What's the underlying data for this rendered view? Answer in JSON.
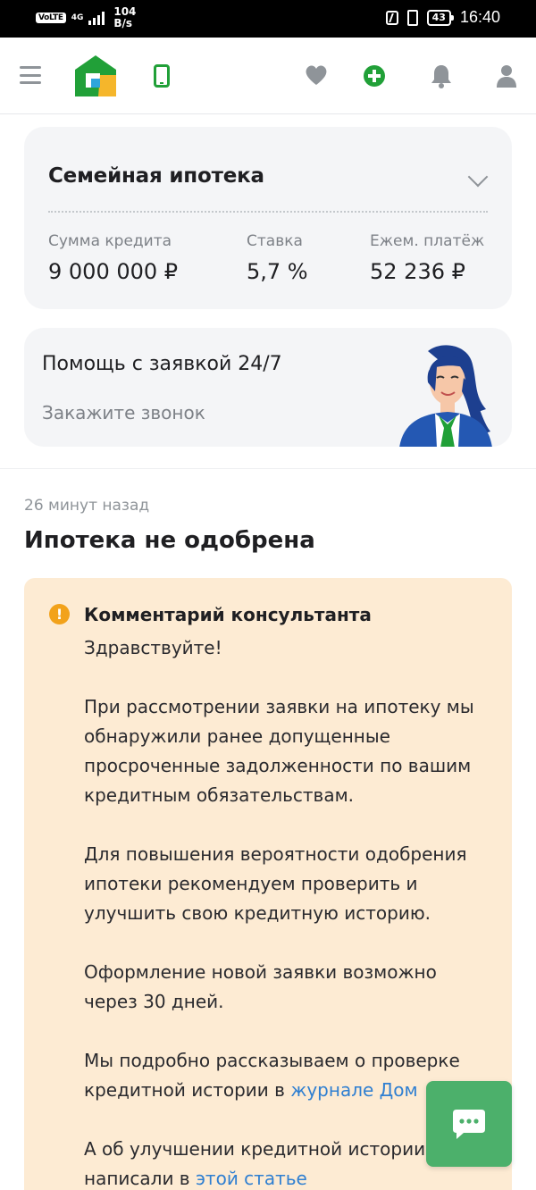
{
  "status_bar": {
    "volte": "VoLTE",
    "network": "4G",
    "speed_value": "104",
    "speed_unit": "B/s",
    "battery": "43",
    "time": "16:40"
  },
  "header": {
    "icons": [
      "menu-icon",
      "logo",
      "phone-icon",
      "heart-icon",
      "plus-icon",
      "bell-icon",
      "user-icon"
    ]
  },
  "mortgage": {
    "title": "Семейная ипотека",
    "stats": [
      {
        "label": "Сумма кредита",
        "value": "9 000 000 ₽"
      },
      {
        "label": "Ставка",
        "value": "5,7 %"
      },
      {
        "label": "Ежем. платёж",
        "value": "52 236 ₽"
      }
    ]
  },
  "help": {
    "title": "Помощь с заявкой 24/7",
    "subtitle": "Закажите звонок"
  },
  "application": {
    "time_ago": "26 минут назад",
    "status": "Ипотека не одобрена"
  },
  "comment": {
    "heading": "Комментарий консультанта",
    "greeting": "Здравствуйте!",
    "p1": "При рассмотрении заявки на ипотеку мы обнаружили ранее допущенные просроченные задолженности по вашим кредитным обязательствам.",
    "p2": "Для повышения вероятности одобрения ипотеки рекомендуем проверить и улучшить свою кредитную историю.",
    "p3": "Оформление новой заявки возможно через 30 дней.",
    "p4_text": "Мы подробно рассказываем о проверке кредитной истории в ",
    "p4_link": "журнале Дом",
    "p5_text": "А об улучшении кредитной истории написали в ",
    "p5_link": "этой статье"
  },
  "colors": {
    "brand_green": "#21a038",
    "comment_bg": "#fdebd3",
    "warning": "#f2a21b",
    "link": "#2f7fd1",
    "chat_button": "#4cb06b"
  }
}
